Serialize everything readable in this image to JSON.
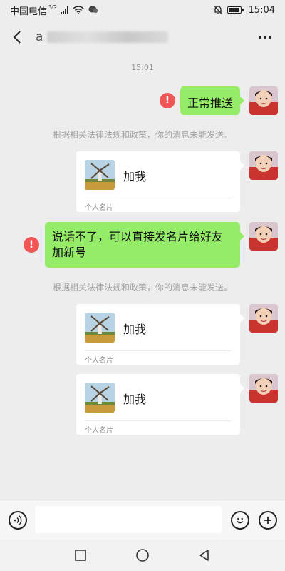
{
  "status_bar": {
    "carrier": "中国电信",
    "network_type": "3G",
    "time": "15:04"
  },
  "header": {
    "title_prefix": "a"
  },
  "chat": {
    "timestamp": "15:01",
    "messages": [
      {
        "kind": "text",
        "from": "me",
        "text": "正常推送",
        "failed": true,
        "error_mark": "!"
      },
      {
        "kind": "system",
        "text": "根据相关法律法规和政策，你的消息未能发送。"
      },
      {
        "kind": "card",
        "from": "me",
        "name": "加我",
        "type_label": "个人名片"
      },
      {
        "kind": "text",
        "from": "me",
        "text": "说话不了，可以直接发名片给好友加新号",
        "failed": true,
        "error_mark": "!"
      },
      {
        "kind": "system",
        "text": "根据相关法律法规和政策，你的消息未能发送。"
      },
      {
        "kind": "card",
        "from": "me",
        "name": "加我",
        "type_label": "个人名片"
      },
      {
        "kind": "card",
        "from": "me",
        "name": "加我",
        "type_label": "个人名片"
      }
    ]
  },
  "input_bar": {
    "value": "",
    "placeholder": ""
  },
  "icons": {
    "voice": "voice-input-icon",
    "emoji": "emoji-icon",
    "plus": "plus-icon",
    "back": "back-arrow-icon",
    "more": "more-dots-icon"
  },
  "colors": {
    "bubble_green": "#95ec69",
    "error_red": "#f25657",
    "background": "#ededed"
  }
}
